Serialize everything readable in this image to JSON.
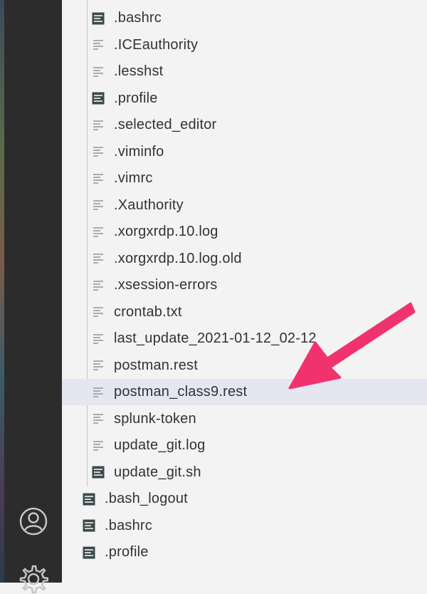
{
  "explorer": {
    "partial_item": {
      "label": "",
      "icon": "text-file-icon"
    },
    "nested_items": [
      {
        "label": ".bashrc",
        "icon": "shell-file-icon"
      },
      {
        "label": ".ICEauthority",
        "icon": "text-file-icon"
      },
      {
        "label": ".lesshst",
        "icon": "text-file-icon"
      },
      {
        "label": ".profile",
        "icon": "shell-file-icon"
      },
      {
        "label": ".selected_editor",
        "icon": "text-file-icon"
      },
      {
        "label": ".viminfo",
        "icon": "text-file-icon"
      },
      {
        "label": ".vimrc",
        "icon": "text-file-icon"
      },
      {
        "label": ".Xauthority",
        "icon": "text-file-icon"
      },
      {
        "label": ".xorgxrdp.10.log",
        "icon": "text-file-icon"
      },
      {
        "label": ".xorgxrdp.10.log.old",
        "icon": "text-file-icon"
      },
      {
        "label": ".xsession-errors",
        "icon": "text-file-icon"
      },
      {
        "label": "crontab.txt",
        "icon": "text-file-icon"
      },
      {
        "label": "last_update_2021-01-12_02-12",
        "icon": "text-file-icon"
      },
      {
        "label": "postman.rest",
        "icon": "text-file-icon"
      },
      {
        "label": "postman_class9.rest",
        "icon": "text-file-icon",
        "selected": true
      },
      {
        "label": "splunk-token",
        "icon": "text-file-icon"
      },
      {
        "label": "update_git.log",
        "icon": "text-file-icon"
      },
      {
        "label": "update_git.sh",
        "icon": "shell-file-icon"
      }
    ],
    "root_items": [
      {
        "label": ".bash_logout",
        "icon": "shell-file-icon"
      },
      {
        "label": ".bashrc",
        "icon": "shell-file-icon"
      },
      {
        "label": ".profile",
        "icon": "shell-file-icon"
      }
    ]
  },
  "activity_bar": {
    "icons": [
      "account-icon",
      "settings-gear-icon"
    ]
  },
  "annotation": {
    "icon": "arrow-annotation",
    "color": "#f0336e"
  },
  "colors": {
    "selection_bg": "#e4e6f1",
    "sidebar_bg": "#f3f3f3",
    "activity_bar_bg": "#2c2c2c",
    "text": "#333333"
  }
}
